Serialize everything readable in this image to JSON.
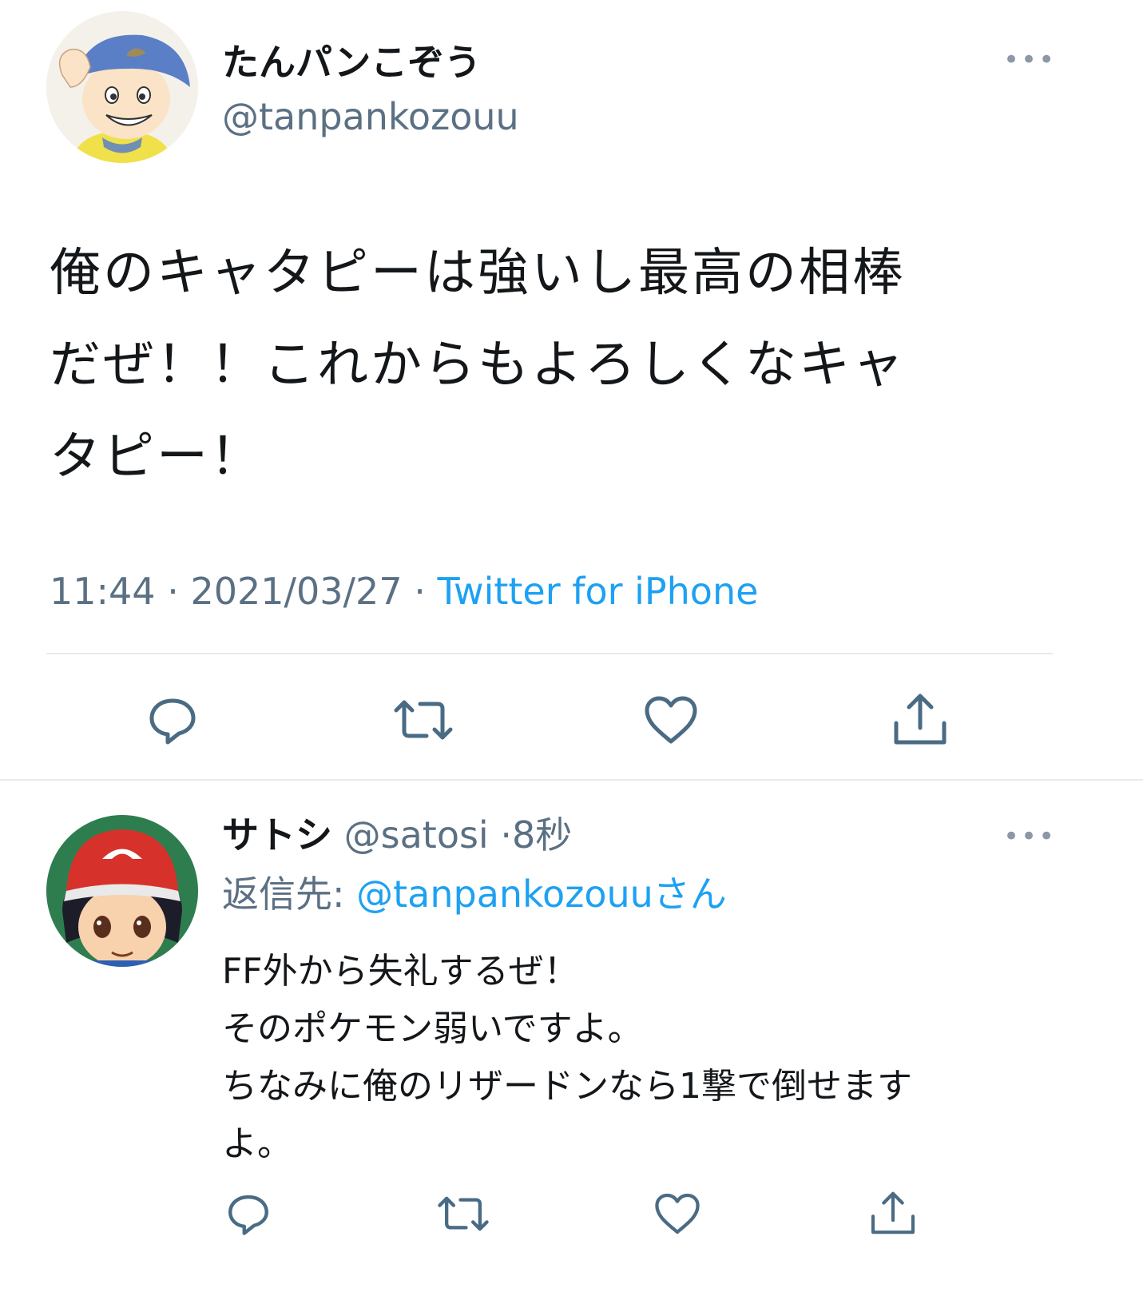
{
  "main_tweet": {
    "display_name": "たんパンこぞう",
    "handle": "@tanpankozouu",
    "text_lines": [
      "俺のキャタピーは強いし最高の相棒",
      "だぜ！！これからもよろしくなキャ",
      "タピー！"
    ],
    "time": "11:44",
    "sep1": "·",
    "date": "2021/03/27",
    "sep2": "·",
    "source": "Twitter for iPhone"
  },
  "reply": {
    "display_name": "サトシ",
    "handle": "@satosi",
    "time_sep": "·",
    "time": "8秒",
    "reply_prefix": "返信先:",
    "reply_to": "@tanpankozouuさん",
    "text_lines": [
      "FF外から失礼するぜ！",
      "そのポケモン弱いですよ。",
      "ちなみに俺のリザードンなら1撃で倒せます",
      "よ。"
    ]
  },
  "more_label": "•••",
  "colors": {
    "muted": "#5b7083",
    "link": "#1da1f2",
    "icon": "#4a6b84",
    "divider": "#e6ecf0"
  },
  "icons": [
    "reply-icon",
    "retweet-icon",
    "like-icon",
    "share-icon",
    "more-icon"
  ]
}
